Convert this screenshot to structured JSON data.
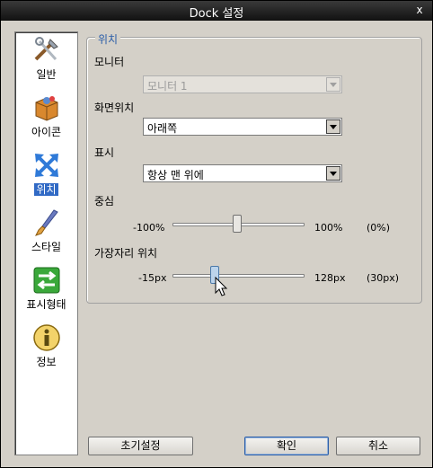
{
  "window": {
    "title": "Dock 설정",
    "close": "x"
  },
  "sidebar": {
    "items": [
      {
        "label": "일반",
        "icon": "tools-icon",
        "selected": false
      },
      {
        "label": "아이콘",
        "icon": "box-icon",
        "selected": false
      },
      {
        "label": "위치",
        "icon": "arrows-icon",
        "selected": true
      },
      {
        "label": "스타일",
        "icon": "brush-icon",
        "selected": false
      },
      {
        "label": "표시형태",
        "icon": "exchange-icon",
        "selected": false
      },
      {
        "label": "정보",
        "icon": "info-icon",
        "selected": false
      }
    ]
  },
  "group": {
    "title": "위치"
  },
  "monitor": {
    "label": "모니터",
    "value": "모니터 1",
    "disabled": true
  },
  "screen_position": {
    "label": "화면위치",
    "value": "아래쪽"
  },
  "display": {
    "label": "표시",
    "value": "항상 맨 위에"
  },
  "center": {
    "label": "중심",
    "min": "-100%",
    "max": "100%",
    "value_text": "(0%)",
    "value": 0
  },
  "edge": {
    "label": "가장자리 위치",
    "min": "-15px",
    "max": "128px",
    "value_text": "(30px)",
    "value": 30
  },
  "buttons": {
    "reset": "초기설정",
    "ok": "확인",
    "cancel": "취소"
  },
  "colors": {
    "selection": "#316ac5",
    "group_title": "#2a5da8"
  }
}
